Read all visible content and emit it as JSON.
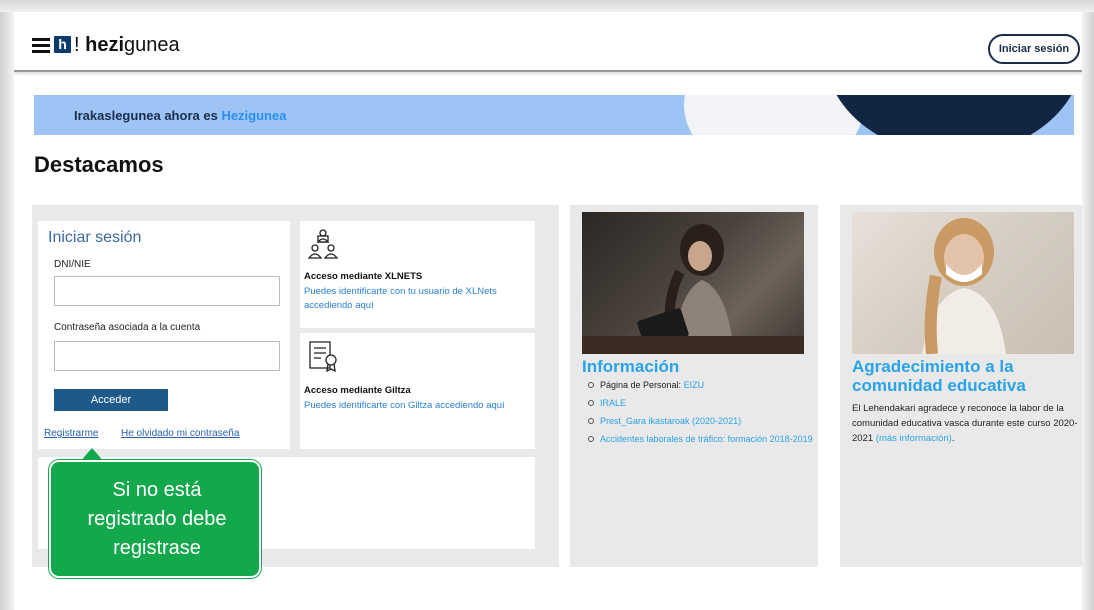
{
  "header": {
    "logo_mark": "h",
    "brand_prefix": "!",
    "brand_bold": "hezi",
    "brand_rest": "gunea",
    "login_button": "Iniciar sesión"
  },
  "banner": {
    "text": "Irakaslegunea ahora es",
    "highlight": "Hezigunea"
  },
  "section_title": "Destacamos",
  "login": {
    "title": "Iniciar sesión",
    "dni_label": "DNI/NIE",
    "dni_value": "",
    "password_label": "Contraseña asociada a la cuenta",
    "password_value": "",
    "submit": "Acceder",
    "register": "Registrarme",
    "forgot": "He olvidado mi contraseña"
  },
  "xlnets": {
    "title": "Acceso mediante XLNETS",
    "description": "Puedes identificarte con tu usuario de XLNets accediendo aquí"
  },
  "giltza": {
    "title": "Acceso mediante Giltza",
    "description": "Puedes identificarte con Giltza accediendo aquí"
  },
  "informacion": {
    "title": "Información",
    "items": [
      {
        "prefix": "Página de Personal: ",
        "link": "EIZU"
      },
      {
        "prefix": "",
        "link": "IRALE"
      },
      {
        "prefix": "",
        "link": "Prest_Gara ikastaroak (2020-2021)"
      },
      {
        "prefix": "",
        "link": "Accidentes laborales de tráfico: formación 2018-2019"
      }
    ]
  },
  "agradecimiento": {
    "title_line1": "Agradecimiento a la",
    "title_line2": "comunidad educativa",
    "text": "El Lehendakari agradece y reconoce la labor de la comunidad educativa vasca durante este curso 2020-2021 ",
    "more": "(más información)",
    "end": "."
  },
  "callout": {
    "line1": "Si no está",
    "line2": "registrado debe",
    "line3": "registrase"
  },
  "colors": {
    "navy": "#122543",
    "banner": "#9ec4f5",
    "accent_blue": "#2aa3e8",
    "button_blue": "#1d5a8a",
    "callout_green": "#13a84c"
  }
}
